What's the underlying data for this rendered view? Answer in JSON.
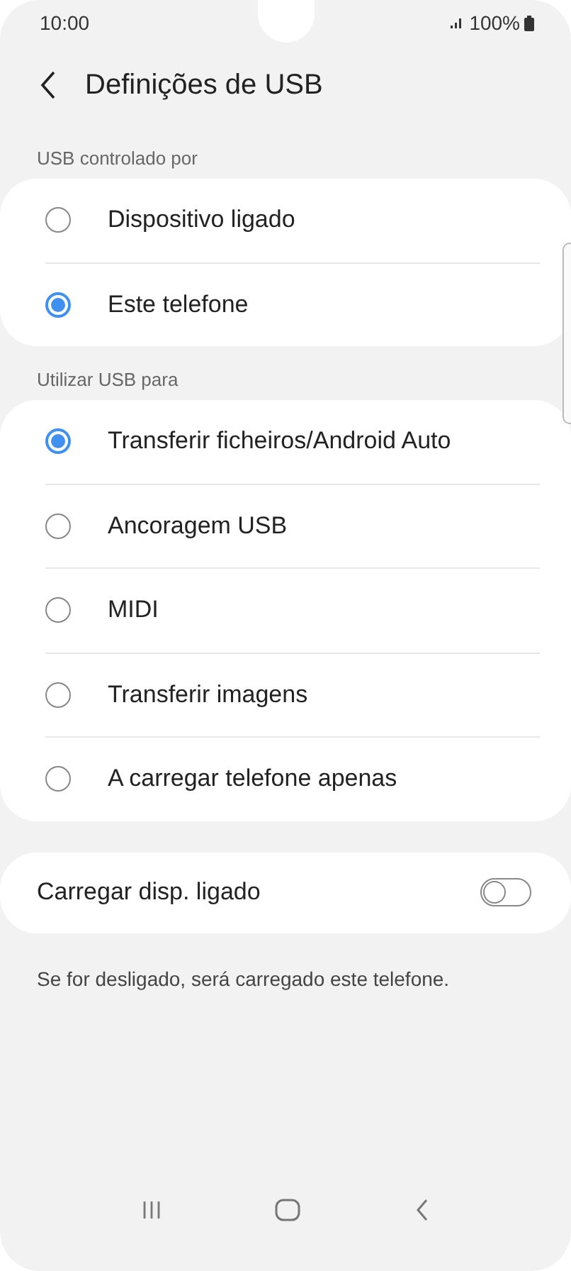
{
  "status_bar": {
    "time": "10:00",
    "battery": "100%"
  },
  "header": {
    "title": "Definições de USB"
  },
  "groups": [
    {
      "label": "USB controlado por",
      "options": [
        {
          "label": "Dispositivo ligado",
          "selected": false
        },
        {
          "label": "Este telefone",
          "selected": true
        }
      ]
    },
    {
      "label": "Utilizar USB para",
      "options": [
        {
          "label": "Transferir ficheiros/Android Auto",
          "selected": true
        },
        {
          "label": "Ancoragem USB",
          "selected": false
        },
        {
          "label": "MIDI",
          "selected": false
        },
        {
          "label": "Transferir imagens",
          "selected": false
        },
        {
          "label": "A carregar telefone apenas",
          "selected": false
        }
      ]
    }
  ],
  "switch_row": {
    "label": "Carregar disp. ligado",
    "on": false
  },
  "footer_note": "Se for desligado, será carregado este telefone."
}
